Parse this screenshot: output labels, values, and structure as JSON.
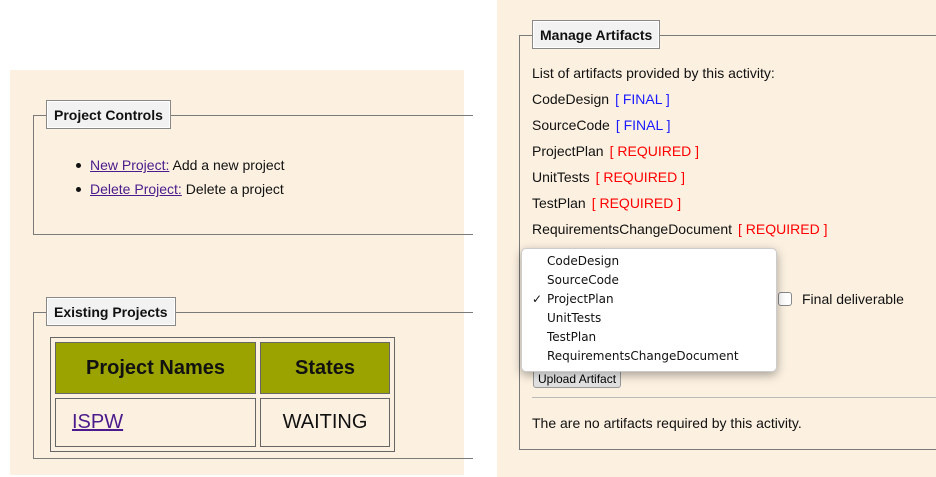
{
  "project_controls": {
    "legend": "Project Controls",
    "items": [
      {
        "link": "New Project:",
        "text": " Add a new project"
      },
      {
        "link": "Delete Project:",
        "text": " Delete a project"
      }
    ]
  },
  "existing_projects": {
    "legend": "Existing Projects",
    "headers": [
      "Project Names",
      "States"
    ],
    "rows": [
      {
        "name": "ISPW",
        "state": "WAITING"
      }
    ]
  },
  "manage_artifacts": {
    "legend": "Manage Artifacts",
    "intro": "List of artifacts provided by this activity:",
    "artifacts": [
      {
        "name": "CodeDesign",
        "status": "[ FINAL ]"
      },
      {
        "name": "SourceCode",
        "status": "[ FINAL ]"
      },
      {
        "name": "ProjectPlan",
        "status": "[ REQUIRED ]"
      },
      {
        "name": "UnitTests",
        "status": "[ REQUIRED ]"
      },
      {
        "name": "TestPlan",
        "status": "[ REQUIRED ]"
      },
      {
        "name": "RequirementsChangeDocument",
        "status": "[ REQUIRED ]"
      }
    ],
    "dropdown_options": [
      "CodeDesign",
      "SourceCode",
      "ProjectPlan",
      "UnitTests",
      "TestPlan",
      "RequirementsChangeDocument"
    ],
    "selected_option": "ProjectPlan",
    "checkmark": "✓",
    "final_deliverable_label": "Final deliverable",
    "upload_button": "Upload Artifact",
    "no_required_msg": "The are no artifacts required by this activity."
  },
  "colors": {
    "panel_bg": "#fcf1e1",
    "table_header_bg": "#9aa300",
    "link": "#4b1a8c",
    "final": "#1a1aff",
    "required": "#ff0000"
  }
}
